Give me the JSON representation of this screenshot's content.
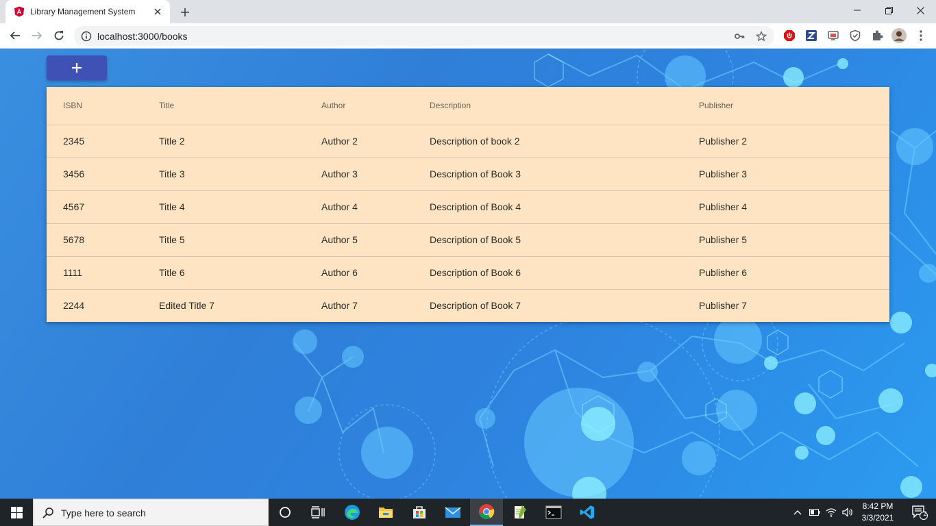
{
  "browser": {
    "tab": {
      "title": "Library Management System",
      "favicon": "angular-logo-icon"
    },
    "url": "localhost:3000/books"
  },
  "app": {
    "add_button_label": "+",
    "table": {
      "headers": [
        "ISBN",
        "Title",
        "Author",
        "Description",
        "Publisher"
      ],
      "rows": [
        [
          "2345",
          "Title 2",
          "Author 2",
          "Description of book 2",
          "Publisher 2"
        ],
        [
          "3456",
          "Title 3",
          "Author 3",
          "Description of Book 3",
          "Publisher 3"
        ],
        [
          "4567",
          "Title 4",
          "Author 4",
          "Description of Book 4",
          "Publisher 4"
        ],
        [
          "5678",
          "Title 5",
          "Author 5",
          "Description of Book 5",
          "Publisher 5"
        ],
        [
          "1111",
          "Title 6",
          "Author 6",
          "Description of Book 6",
          "Publisher 6"
        ],
        [
          "2244",
          "Edited Title 7",
          "Author 7",
          "Description of Book 7",
          "Publisher 7"
        ]
      ]
    }
  },
  "taskbar": {
    "search_placeholder": "Type here to search",
    "time": "8:42 PM",
    "date": "3/3/2021",
    "notification_count": "2"
  },
  "colors": {
    "add_button": "#3f51b5",
    "table_background": "#ffe4c4",
    "page_background": "#2b7fd6",
    "taskbar": "#1f2428"
  }
}
